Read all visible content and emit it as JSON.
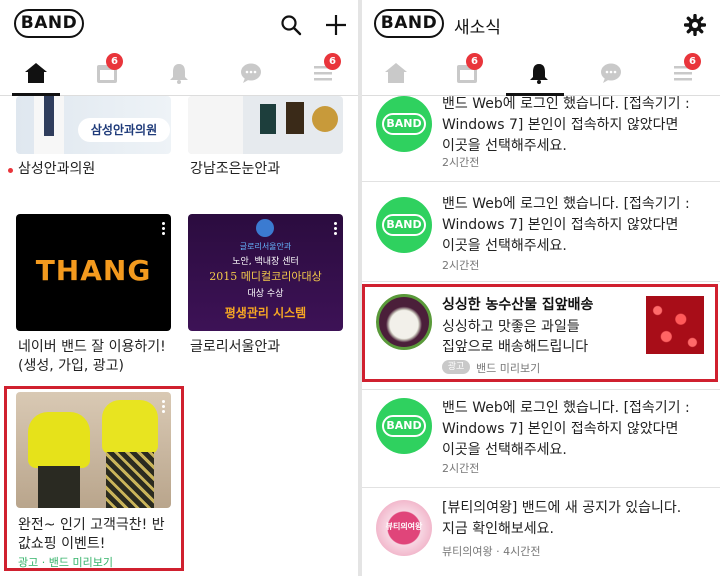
{
  "left": {
    "logo": "BAND",
    "tabs": [
      {
        "icon": "home-icon",
        "badge": ""
      },
      {
        "icon": "calendar-icon",
        "badge": "6"
      },
      {
        "icon": "bell-icon",
        "badge": ""
      },
      {
        "icon": "chat-icon",
        "badge": ""
      },
      {
        "icon": "menu-icon",
        "badge": "6"
      }
    ],
    "cards": [
      {
        "title": "삼성안과의원",
        "thumb_text": "삼성안과의원",
        "has_dot": true
      },
      {
        "title": "강남조은눈안과",
        "thumb_text": ""
      },
      {
        "title_line1": "네이버 밴드 잘 이용하기!",
        "title_line2": "(생성, 가입, 광고)",
        "thumb_text": "THANG"
      },
      {
        "title": "글로리서울안과",
        "thumb_lines": [
          "글로리서울안과",
          "노안, 백내장 센터",
          "2015 메디컬코리아대상",
          "대상 수상",
          "평생관리 시스템"
        ]
      }
    ],
    "ad": {
      "title_line1": "완전~ 인기 고객극찬! 반",
      "title_line2": "값쇼핑 이벤트!",
      "sub": "광고 · 밴드 미리보기"
    }
  },
  "right": {
    "logo": "BAND",
    "header_title": "새소식",
    "tabs": [
      {
        "icon": "home-icon",
        "badge": ""
      },
      {
        "icon": "calendar-icon",
        "badge": "6"
      },
      {
        "icon": "bell-icon",
        "badge": ""
      },
      {
        "icon": "chat-icon",
        "badge": ""
      },
      {
        "icon": "menu-icon",
        "badge": "6"
      }
    ],
    "feed": [
      {
        "lines": [
          "밴드 Web에 로그인 했습니다. [접속기기 :",
          "Windows 7] 본인이 접속하지 않았다면",
          "이곳을 선택해주세요."
        ],
        "time": "2시간전",
        "icon": "BAND"
      },
      {
        "lines": [
          "밴드 Web에 로그인 했습니다. [접속기기 :",
          "Windows 7] 본인이 접속하지 않았다면",
          "이곳을 선택해주세요."
        ],
        "time": "2시간전",
        "icon": "BAND"
      }
    ],
    "ad": {
      "title": "싱싱한 농수산물 집앞배송",
      "lines": [
        "싱싱하고 맛좋은 과일들",
        "집앞으로 배송해드립니다"
      ],
      "tag": "광고",
      "sub": "밴드 미리보기"
    },
    "feed2": [
      {
        "lines": [
          "밴드 Web에 로그인 했습니다. [접속기기 :",
          "Windows 7] 본인이 접속하지 않았다면",
          "이곳을 선택해주세요."
        ],
        "time": "2시간전",
        "icon": "BAND"
      },
      {
        "lines": [
          "[뷰티의여왕] 밴드에 새 공지가 있습니다.",
          "지금 확인해보세요."
        ],
        "time": "뷰티의여왕 · 4시간전",
        "icon_text": "뷰티의여왕"
      }
    ]
  }
}
